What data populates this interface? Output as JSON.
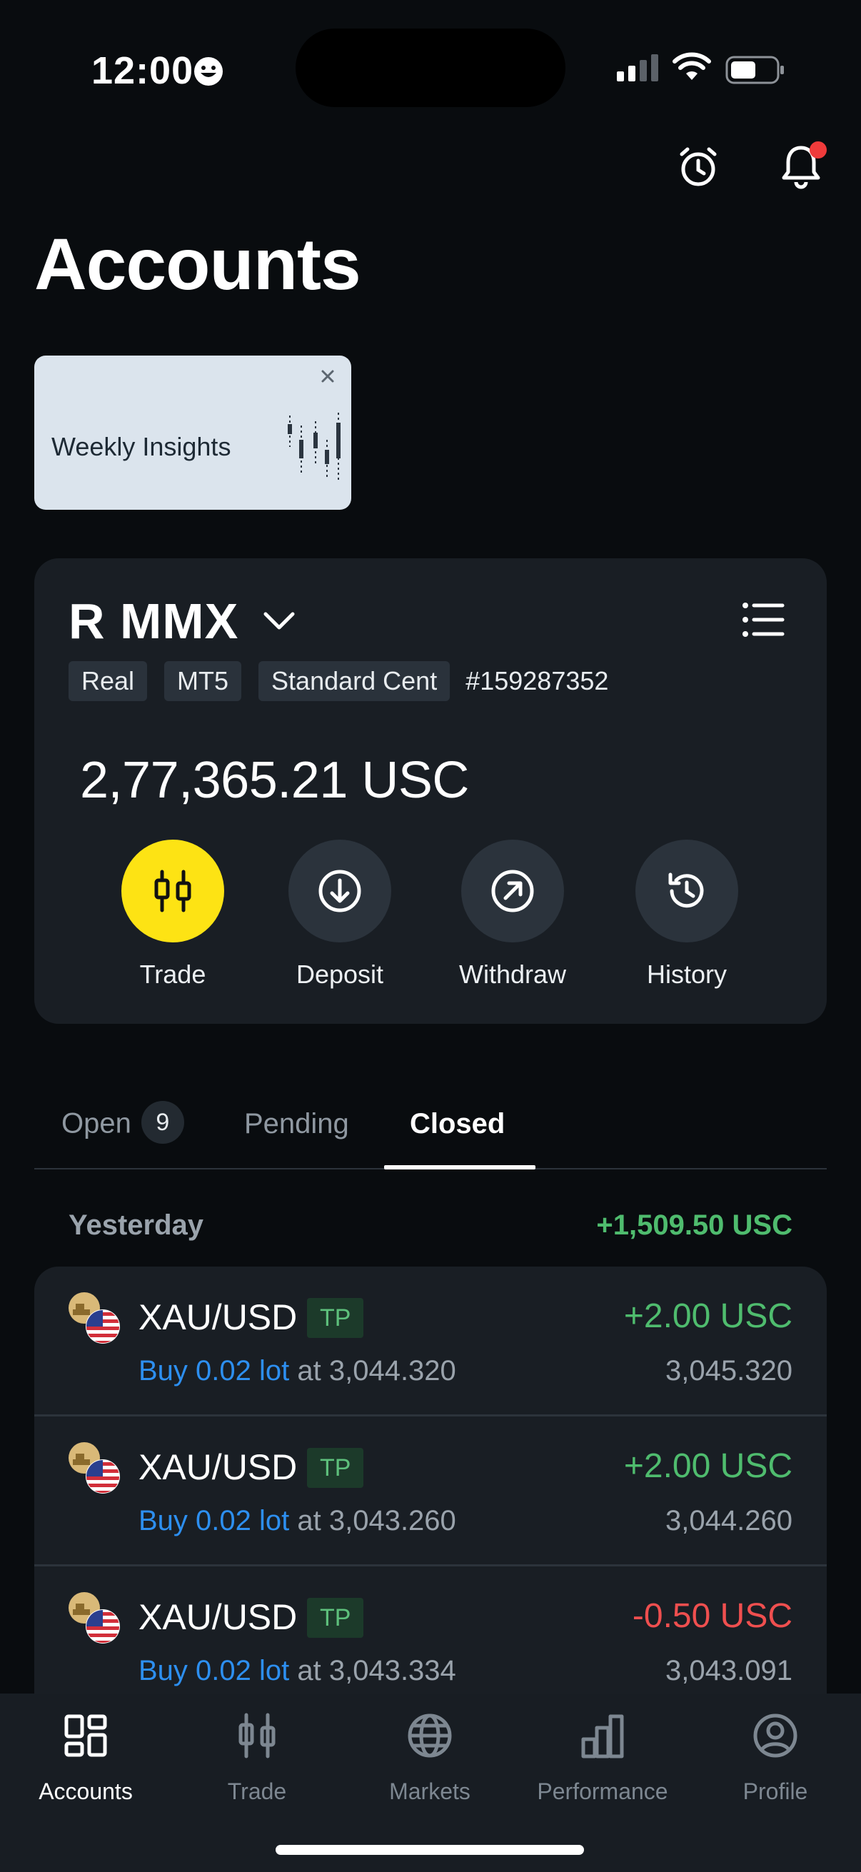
{
  "status": {
    "time": "12:00"
  },
  "header": {
    "title": "Accounts"
  },
  "insight": {
    "text": "Weekly Insights"
  },
  "account": {
    "name": "R MMX",
    "tags": [
      "Real",
      "MT5",
      "Standard Cent"
    ],
    "number": "#159287352",
    "balance": "2,77,365.21 USC",
    "actions": {
      "trade": "Trade",
      "deposit": "Deposit",
      "withdraw": "Withdraw",
      "history": "History"
    }
  },
  "tabs": {
    "open": "Open",
    "open_count": "9",
    "pending": "Pending",
    "closed": "Closed"
  },
  "closed": {
    "day_label": "Yesterday",
    "day_total": "+1,509.50 USC",
    "trades": [
      {
        "symbol": "XAU/USD",
        "badge": "TP",
        "pl": "+2.00 USC",
        "side": "Buy 0.02 lot",
        "open_price": "at 3,044.320",
        "close_price": "3,045.320"
      },
      {
        "symbol": "XAU/USD",
        "badge": "TP",
        "pl": "+2.00 USC",
        "side": "Buy 0.02 lot",
        "open_price": "at 3,043.260",
        "close_price": "3,044.260"
      },
      {
        "symbol": "XAU/USD",
        "badge": "TP",
        "pl": "-0.50 USC",
        "side": "Buy 0.02 lot",
        "open_price": "at 3,043.334",
        "close_price": "3,043.091"
      }
    ]
  },
  "nav": {
    "accounts": "Accounts",
    "trade": "Trade",
    "markets": "Markets",
    "performance": "Performance",
    "profile": "Profile"
  },
  "colors": {
    "accent": "#fde314",
    "profit": "#4fbc6e",
    "loss": "#ef4f4f",
    "link": "#2d8ff0",
    "background": "#090c0f",
    "card": "#191e24"
  }
}
